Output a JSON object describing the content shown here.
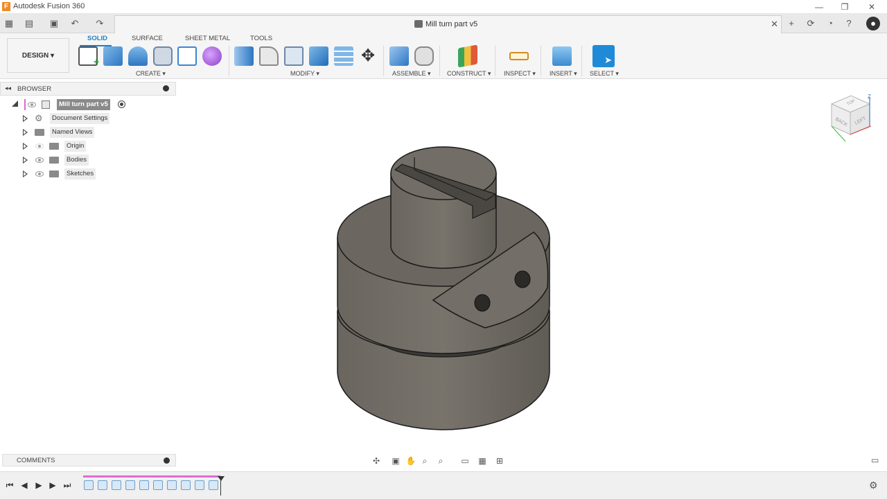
{
  "app": {
    "title": "Autodesk Fusion 360",
    "logo_letter": "F"
  },
  "document": {
    "tab_title": "Mill turn part v5"
  },
  "toolbar": {
    "workspace": "DESIGN ▾",
    "tabs": [
      "SOLID",
      "SURFACE",
      "SHEET METAL",
      "TOOLS"
    ],
    "active_tab": "SOLID",
    "groups": {
      "create": "CREATE ▾",
      "modify": "MODIFY ▾",
      "assemble": "ASSEMBLE ▾",
      "construct": "CONSTRUCT ▾",
      "inspect": "INSPECT ▾",
      "insert": "INSERT ▾",
      "select": "SELECT ▾"
    }
  },
  "browser": {
    "title": "BROWSER",
    "root": "Mill turn part v5",
    "items": [
      {
        "label": "Document Settings",
        "icon": "gear-icon"
      },
      {
        "label": "Named Views",
        "icon": "folder-icon"
      },
      {
        "label": "Origin",
        "icon": "folder-icon"
      },
      {
        "label": "Bodies",
        "icon": "folder-icon"
      },
      {
        "label": "Sketches",
        "icon": "folder-icon"
      }
    ]
  },
  "viewcube": {
    "front": "BACK",
    "side": "LEFT",
    "top": "TOP",
    "axis_z": "Z"
  },
  "comments": {
    "title": "COMMENTS"
  },
  "colors": {
    "accent": "#1f7fc5",
    "timeline_bar": "#e06ad4",
    "model_body": "#6e6a63"
  }
}
